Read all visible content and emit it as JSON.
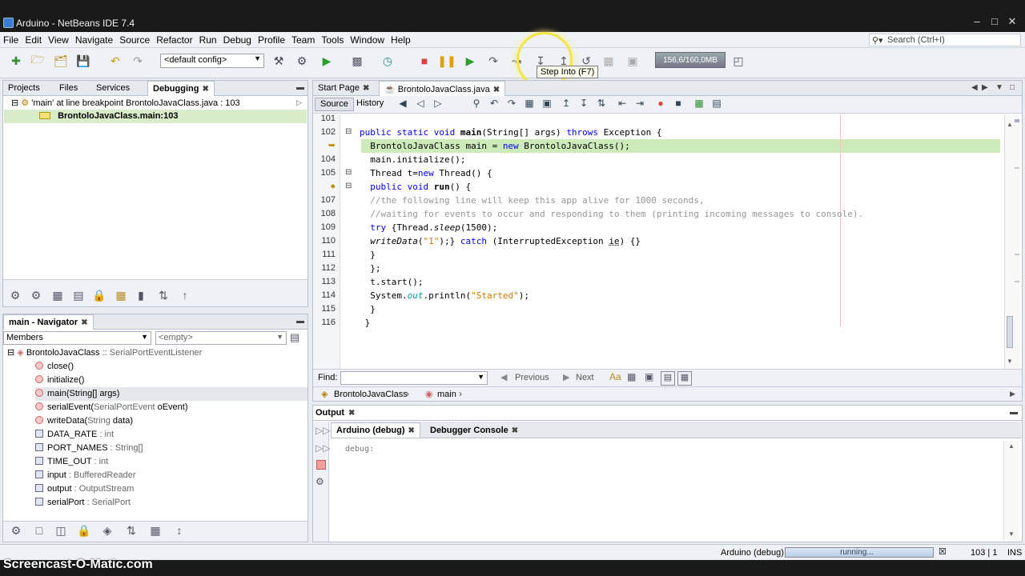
{
  "window": {
    "title": "Arduino - NetBeans IDE 7.4",
    "controls": [
      "minimize-icon",
      "maximize-icon",
      "close-icon"
    ]
  },
  "menu": [
    "File",
    "Edit",
    "View",
    "Navigate",
    "Source",
    "Refactor",
    "Run",
    "Debug",
    "Profile",
    "Team",
    "Tools",
    "Window",
    "Help"
  ],
  "search": {
    "placeholder": "Search (Ctrl+I)"
  },
  "toolbar": {
    "config": "<default config>",
    "memory": "156,6/160,0MB",
    "tooltip": "Step Into (F7)"
  },
  "left_top": {
    "tabs": [
      "Projects",
      "Files",
      "Services",
      "Debugging"
    ],
    "rows": [
      "'main' at line breakpoint BrontoloJavaClass.java : 103",
      "BrontoloJavaClass.main:103"
    ]
  },
  "navigator": {
    "title": "main - Navigator",
    "members_label": "Members",
    "filter_value": "<empty>",
    "root": {
      "name": "BrontoloJavaClass",
      "rest": " :: SerialPortEventListener"
    },
    "items": [
      {
        "name": "close()",
        "type": "",
        "kind": "method"
      },
      {
        "name": "initialize()",
        "type": "",
        "kind": "method"
      },
      {
        "name": "main(String[] args)",
        "type": "",
        "kind": "method"
      },
      {
        "name": "serialEvent(",
        "type": "SerialPortEvent",
        "extra": " oEvent)",
        "kind": "method"
      },
      {
        "name": "writeData(",
        "type": "String",
        "extra": " data)",
        "kind": "method"
      },
      {
        "name": "DATA_RATE",
        "type": " : int",
        "kind": "field"
      },
      {
        "name": "PORT_NAMES",
        "type": " : String[]",
        "kind": "field"
      },
      {
        "name": "TIME_OUT",
        "type": " : int",
        "kind": "field"
      },
      {
        "name": "input",
        "type": " : BufferedReader",
        "kind": "field"
      },
      {
        "name": "output",
        "type": " : OutputStream",
        "kind": "field"
      },
      {
        "name": "serialPort",
        "type": " : SerialPort",
        "kind": "field"
      }
    ]
  },
  "editor": {
    "tabs": [
      "Start Page",
      "BrontoloJavaClass.java"
    ],
    "source_tab": "Source",
    "history_tab": "History",
    "line_numbers": [
      "101",
      "102",
      "",
      "104",
      "105",
      "",
      "107",
      "108",
      "109",
      "110",
      "111",
      "112",
      "113",
      "114",
      "115",
      "116"
    ],
    "find_label": "Find:",
    "previous": "Previous",
    "next": "Next",
    "breadcrumb": [
      "BrontoloJavaClass",
      "main"
    ]
  },
  "output": {
    "title": "Output",
    "tabs": [
      "Arduino (debug)",
      "Debugger Console"
    ],
    "text": "debug:"
  },
  "status": {
    "process": "Arduino (debug)",
    "progress": "running...",
    "position": "103 | 1",
    "mode": "INS"
  },
  "watermark": "Screencast-O-Matic.com"
}
